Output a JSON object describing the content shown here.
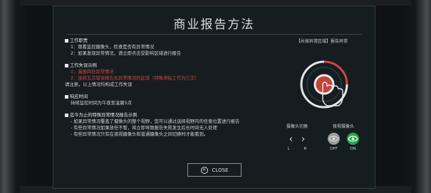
{
  "title": "商业报告方法",
  "sections": [
    {
      "heading": "工作职责",
      "lines": [
        {
          "text": "1：观看监控摄像头，检查是否有异常情况",
          "color": "normal"
        },
        {
          "text": "2：如果发现异常情况，请立即点击受影响区域进行报告",
          "color": "normal"
        }
      ]
    },
    {
      "heading": "工作失误示例",
      "lines": [
        {
          "text": "1：漏报四处异常情况",
          "color": "red"
        },
        {
          "text": "2：连续五次错误报告无异常情况的区域（特殊津贴工作为三次）",
          "color": "red"
        },
        {
          "text": "请注意，以上情况均构成工作失误",
          "color": "plain"
        }
      ]
    },
    {
      "heading": "响应时间",
      "lines": [
        {
          "text": "持续监控时间为午夜至凌晨5点",
          "color": "normal"
        }
      ]
    },
    {
      "heading": "迄今为止的特殊异常情况报告示例",
      "lines": [
        {
          "text": "- 如果异常情况覆盖了摄像头的整个视野，您可以通过选择视野内的任意位置进行报告",
          "color": "normal"
        },
        {
          "text": "- 有些异常情况如果放任不管，将立即导致报告失败发生后长时间无人处理",
          "color": "normal"
        },
        {
          "text": "- 有些异常情况只有在夜视摄像头和普通摄像头之间切换时才能看到。",
          "color": "normal"
        }
      ]
    }
  ],
  "right": {
    "caption": "【长按异常区域】报告异常",
    "camera_switch": {
      "label": "摄像头切换",
      "left": "L",
      "right": "R"
    },
    "night_camera": {
      "label": "夜视摄像头",
      "off": "OFF",
      "on": "ON"
    }
  },
  "close_label": "CLOSE",
  "icons": [
    "press-hold-icon",
    "chevron-left-icon",
    "chevron-right-icon",
    "eye-icon",
    "close-icon"
  ],
  "colors": {
    "accent_red": "#d2453c",
    "on_green": "#2aa84a",
    "off_gray": "#9a9c9d"
  }
}
